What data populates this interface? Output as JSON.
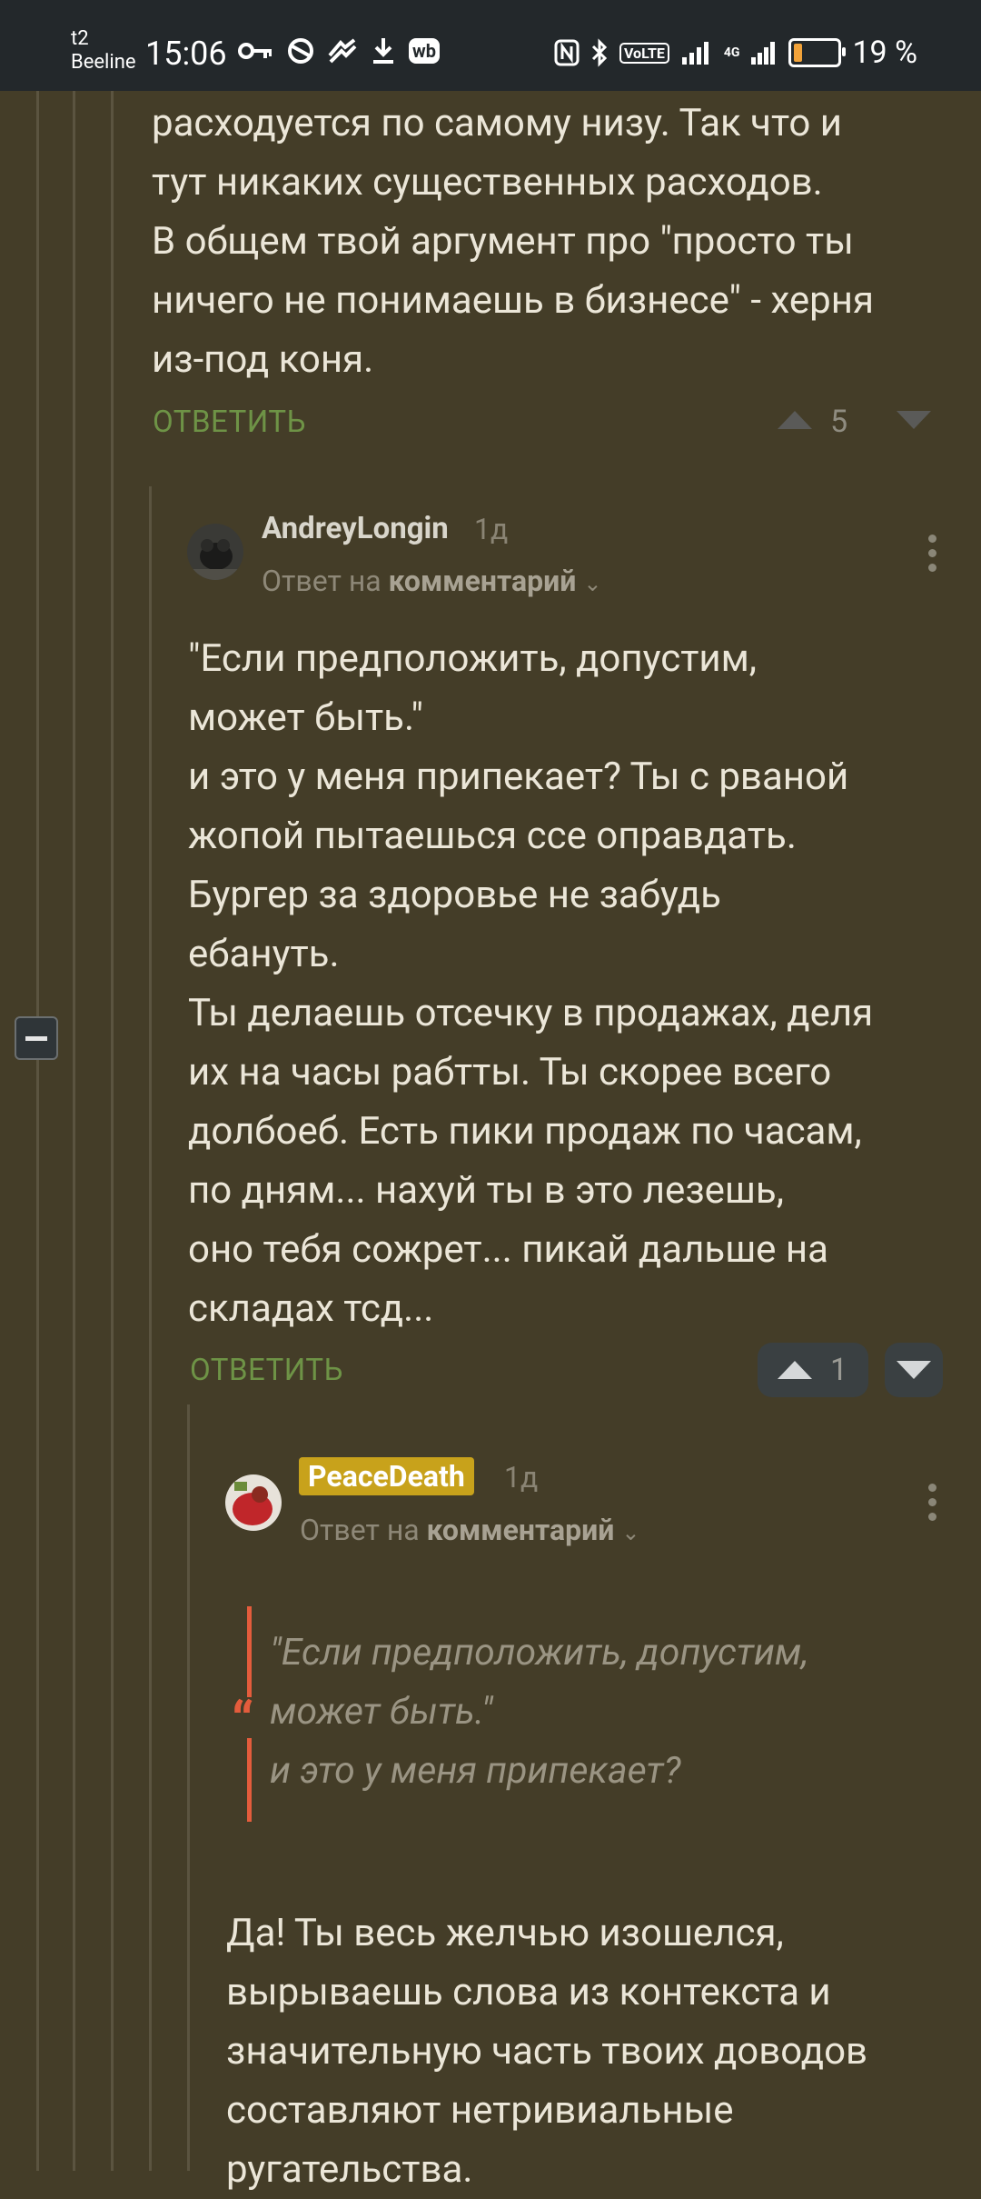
{
  "status_bar": {
    "carrier_line1": "t2",
    "carrier_line2": "Beeline",
    "time": "15:06",
    "network": "4G",
    "volte": "VoLTE",
    "battery_percent_label": "19 %",
    "battery_level": 0.19,
    "wb_label": "wb"
  },
  "parent_comment": {
    "text_lines": [
      "расходуется по самому низу. Так что и",
      "тут никаких существенных расходов.",
      "В общем твой аргумент про \"просто ты",
      "ничего не понимаешь в бизнесе\" - херня",
      "из-под коня."
    ],
    "reply_label": "ОТВЕТИТЬ",
    "rating": "5"
  },
  "comment_1": {
    "username": "AndreyLongin",
    "time": "1д",
    "answer_to_prefix": "Ответ на",
    "answer_to_link": "комментарий",
    "text_lines": [
      "\"Если предположить, допустим,",
      "может быть.\"",
      "и это у меня припекает? Ты с рваной",
      "жопой пытаешься ссе оправдать.",
      "Бургер за здоровье не забудь",
      "ебануть.",
      "Ты делаешь отсечку в продажах, деля",
      "их на часы рабтты. Ты скорее всего",
      "долбоеб. Есть пики продаж по часам,",
      "по дням... нахуй ты в это лезешь,",
      "оно тебя сожрет... пикай дальше на",
      "складах тсд..."
    ],
    "reply_label": "ОТВЕТИТЬ",
    "rating": "1"
  },
  "comment_2": {
    "username": "PeaceDeath",
    "time": "1д",
    "answer_to_prefix": "Ответ на",
    "answer_to_link": "комментарий",
    "quote_lines": [
      "\"Если предположить, допустим,",
      "может быть.\"",
      "и это у меня припекает?"
    ],
    "text_lines": [
      "Да! Ты весь желчью изошелся,",
      "вырываешь слова из контекста и",
      "значительную часть твоих доводов",
      "составляют нетривиальные",
      "ругательства."
    ]
  }
}
